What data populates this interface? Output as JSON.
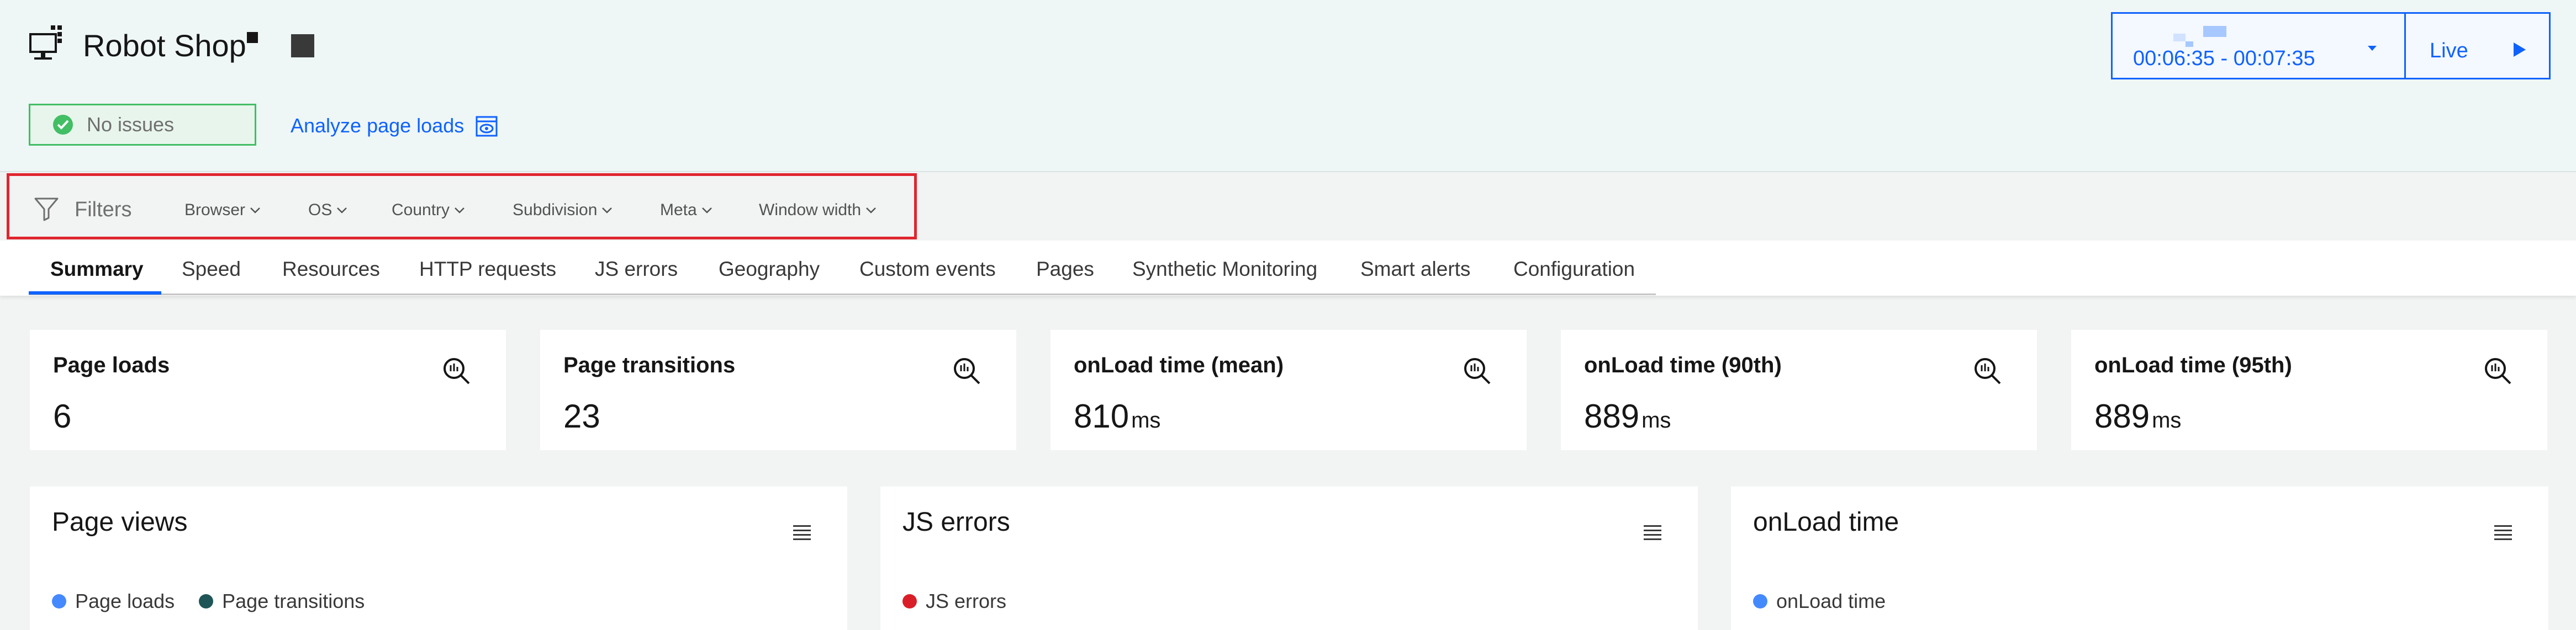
{
  "app": {
    "title": "Robot Shop"
  },
  "status": {
    "label": "No issues",
    "color": "#42be65"
  },
  "analyze": {
    "label": "Analyze page loads"
  },
  "time_picker": {
    "range": "00:06:35 - 00:07:35",
    "live_label": "Live",
    "accent": "#0f62fe"
  },
  "filters": {
    "label": "Filters",
    "dropdowns": [
      "Browser",
      "OS",
      "Country",
      "Subdivision",
      "Meta",
      "Window width"
    ]
  },
  "tabs": [
    {
      "label": "Summary",
      "active": true
    },
    {
      "label": "Speed"
    },
    {
      "label": "Resources"
    },
    {
      "label": "HTTP requests"
    },
    {
      "label": "JS errors"
    },
    {
      "label": "Geography"
    },
    {
      "label": "Custom events"
    },
    {
      "label": "Pages"
    },
    {
      "label": "Synthetic Monitoring"
    },
    {
      "label": "Smart alerts"
    },
    {
      "label": "Configuration"
    }
  ],
  "metrics": [
    {
      "title": "Page loads",
      "value": "6",
      "unit": ""
    },
    {
      "title": "Page transitions",
      "value": "23",
      "unit": ""
    },
    {
      "title": "onLoad time (mean)",
      "value": "810",
      "unit": "ms"
    },
    {
      "title": "onLoad time (90th)",
      "value": "889",
      "unit": "ms"
    },
    {
      "title": "onLoad time (95th)",
      "value": "889",
      "unit": "ms"
    }
  ],
  "charts": [
    {
      "title": "Page views",
      "legend": [
        {
          "label": "Page loads",
          "color": "#4589ff"
        },
        {
          "label": "Page transitions",
          "color": "#1f5556"
        }
      ]
    },
    {
      "title": "JS errors",
      "legend": [
        {
          "label": "JS errors",
          "color": "#da1e28"
        }
      ]
    },
    {
      "title": "onLoad time",
      "legend": [
        {
          "label": "onLoad time",
          "color": "#4589ff"
        }
      ]
    }
  ],
  "icons": {
    "app": "monitor-app-icon",
    "status": "checkmark-icon",
    "analyze": "view-icon",
    "time_caret": "caret-down-icon",
    "live": "play-icon",
    "filters": "funnel-icon",
    "dropdown": "chevron-down-icon",
    "metric": "zoom-in-icon",
    "chart_menu": "menu-icon"
  }
}
